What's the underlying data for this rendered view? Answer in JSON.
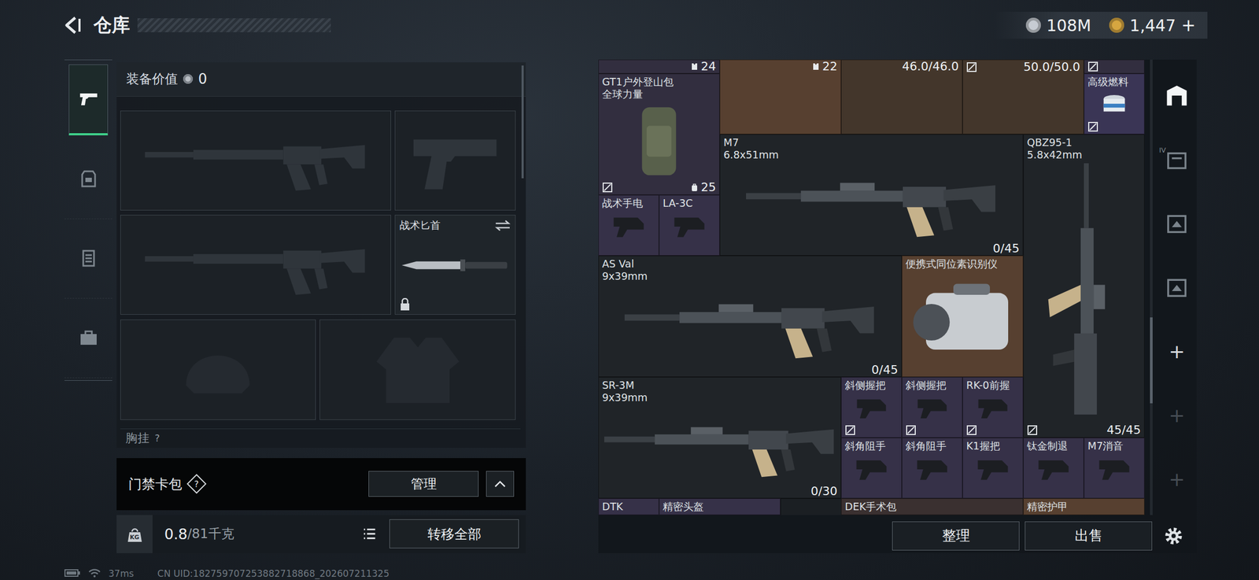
{
  "header": {
    "title": "仓库"
  },
  "currencies": [
    {
      "value": "108M",
      "color": "#c7ccd3"
    },
    {
      "value": "1,447",
      "color": "#d6a640",
      "suffix": "+"
    }
  ],
  "side_tabs": [
    {
      "kind": "pistol",
      "selected": true
    },
    {
      "kind": "armor",
      "selected": false
    },
    {
      "kind": "rig",
      "selected": false
    },
    {
      "kind": "case",
      "selected": false
    }
  ],
  "loadout": {
    "value_label": "装备价值",
    "value": "0",
    "slots": [
      {
        "kind": "rifle"
      },
      {
        "kind": "pistol"
      },
      {
        "kind": "rifle"
      },
      {
        "kind": "knife",
        "label": "战术匕首",
        "locked": true
      },
      {
        "kind": "helmet"
      },
      {
        "kind": "armor"
      }
    ],
    "next_section": {
      "label": "胸挂",
      "help": "?"
    }
  },
  "keycard": {
    "label": "门禁卡包",
    "help": "?",
    "button": "管理"
  },
  "weight": {
    "badge": "KG",
    "current": "0.8",
    "max": "/81千克",
    "button": "转移全部"
  },
  "storage": {
    "items": [
      {
        "kind": "rig",
        "color": "#322e3f",
        "count": "24",
        "marked": false
      },
      {
        "kind": "rig",
        "color": "#574030",
        "count": "22",
        "marked": false
      },
      {
        "kind": "helmet",
        "color": "#43362b",
        "count": "46.0/46.0",
        "marked": false
      },
      {
        "kind": "helmet",
        "color": "#43362b",
        "count": "50.0/50.0",
        "marked": true
      },
      {
        "kind": "misc",
        "color": "#322e3f",
        "marked": true
      },
      {
        "name": "GT1户外登山包",
        "sub": "全球力量",
        "kind": "bag",
        "color": "#322e3f",
        "count": "25",
        "marked": true
      },
      {
        "name": "高级燃料",
        "kind": "consumable",
        "color": "#3a3555",
        "marked": true
      },
      {
        "name": "M7",
        "sub": "6.8x51mm",
        "kind": "weapon",
        "color": "#202428",
        "count": "0/45",
        "marked": false
      },
      {
        "name": "QBZ95-1",
        "sub": "5.8x42mm",
        "kind": "weapon-vertical",
        "color": "#202428",
        "count": "45/45",
        "marked": true
      },
      {
        "name": "战术手电",
        "kind": "attachment",
        "color": "#363148",
        "marked": false
      },
      {
        "name": "LA-3C",
        "kind": "attachment",
        "color": "#363148",
        "marked": false
      },
      {
        "name": "AS Val",
        "sub": "9x39mm",
        "kind": "weapon",
        "color": "#202428",
        "count": "0/45",
        "marked": false
      },
      {
        "name": "便携式同位素识别仪",
        "kind": "device",
        "color": "#574030",
        "marked": false
      },
      {
        "name": "SR-3M",
        "sub": "9x39mm",
        "kind": "weapon",
        "color": "#202428",
        "count": "0/30",
        "marked": false
      },
      {
        "name": "斜侧握把",
        "kind": "attachment",
        "color": "#363148",
        "marked": true
      },
      {
        "name": "斜侧握把",
        "kind": "attachment",
        "color": "#363148",
        "marked": true
      },
      {
        "name": "RK-0前握",
        "kind": "attachment",
        "color": "#363148",
        "marked": true
      },
      {
        "name": "斜角阻手",
        "kind": "attachment",
        "color": "#363148",
        "marked": false
      },
      {
        "name": "斜角阻手",
        "kind": "attachment",
        "color": "#363148",
        "marked": false
      },
      {
        "name": "K1握把",
        "kind": "attachment",
        "color": "#363148",
        "marked": false
      },
      {
        "name": "钛金制退",
        "kind": "attachment",
        "color": "#363148",
        "marked": false
      },
      {
        "name": "M7消音",
        "kind": "attachment",
        "color": "#363148",
        "marked": false
      },
      {
        "name": "DTK",
        "kind": "attachment",
        "color": "#363148",
        "marked": false
      },
      {
        "name": "精密头盔",
        "kind": "helmet",
        "color": "#363148",
        "marked": false
      },
      {
        "name": "DEK手术包",
        "kind": "consumable",
        "color": "#3a3030",
        "marked": false
      },
      {
        "name": "精密护甲",
        "kind": "rig",
        "color": "#574030",
        "marked": false
      }
    ]
  },
  "storage_tabs": [
    {
      "kind": "storage",
      "selected": true,
      "disabled": false
    },
    {
      "kind": "case",
      "badge": "IV",
      "selected": false,
      "disabled": false
    },
    {
      "kind": "box",
      "selected": false,
      "disabled": false
    },
    {
      "kind": "box",
      "selected": false,
      "disabled": false
    },
    {
      "kind": "add",
      "label": "+",
      "selected": false,
      "disabled": false
    },
    {
      "kind": "add",
      "label": "+",
      "selected": false,
      "disabled": true
    },
    {
      "kind": "add",
      "label": "+",
      "selected": false,
      "disabled": true
    }
  ],
  "actions": [
    "整理",
    "出售"
  ],
  "status": {
    "ping": "37ms",
    "uid": "CN UID:182759707253882718868_202607211325"
  }
}
